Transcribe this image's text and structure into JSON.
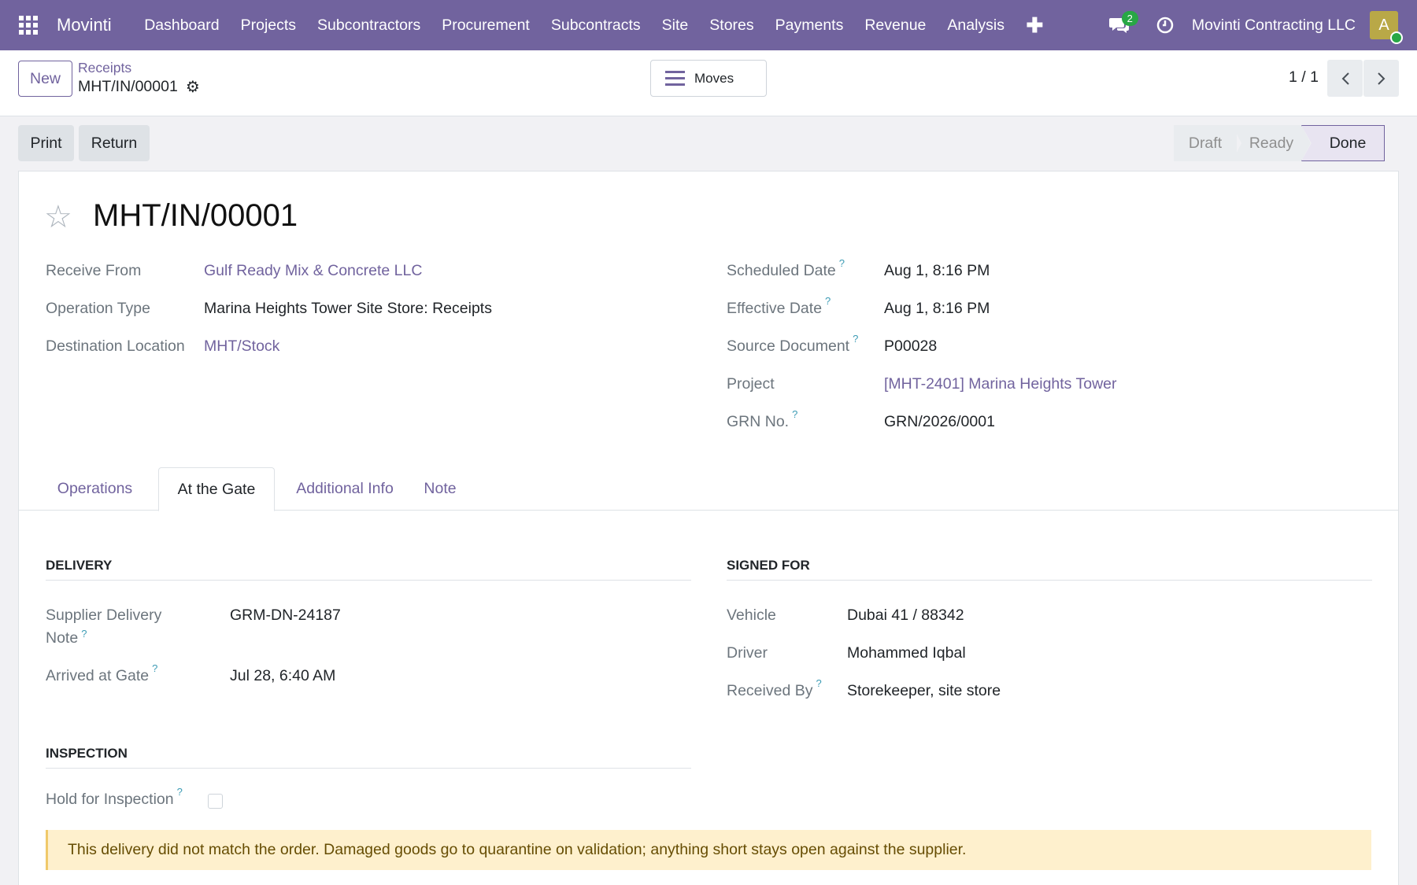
{
  "navbar": {
    "brand": "Movinti",
    "menu": [
      "Dashboard",
      "Projects",
      "Subcontractors",
      "Procurement",
      "Subcontracts",
      "Site",
      "Stores",
      "Payments",
      "Revenue",
      "Analysis"
    ],
    "messages_count": "2",
    "company": "Movinti Contracting LLC",
    "avatar_initial": "A"
  },
  "control_panel": {
    "new_label": "New",
    "breadcrumb": "Receipts",
    "record_name": "MHT/IN/00001",
    "moves_label": "Moves",
    "pager": "1 / 1"
  },
  "statusbar": {
    "print_label": "Print",
    "return_label": "Return",
    "stages": [
      "Draft",
      "Ready",
      "Done"
    ],
    "current_stage": "Done"
  },
  "form": {
    "title": "MHT/IN/00001",
    "left": {
      "receive_from_label": "Receive From",
      "receive_from": "Gulf Ready Mix & Concrete LLC",
      "operation_type_label": "Operation Type",
      "operation_type": "Marina Heights Tower Site Store: Receipts",
      "destination_label": "Destination Location",
      "destination": "MHT/Stock"
    },
    "right": {
      "scheduled_date_label": "Scheduled Date",
      "scheduled_date": "Aug 1, 8:16 PM",
      "effective_date_label": "Effective Date",
      "effective_date": "Aug 1, 8:16 PM",
      "source_document_label": "Source Document",
      "source_document": "P00028",
      "project_label": "Project",
      "project": "[MHT-2401] Marina Heights Tower",
      "grn_label": "GRN No.",
      "grn": "GRN/2026/0001"
    },
    "tabs": [
      "Operations",
      "At the Gate",
      "Additional Info",
      "Note"
    ],
    "active_tab": "At the Gate",
    "delivery": {
      "title": "Delivery",
      "supplier_note_label_1": "Supplier Delivery",
      "supplier_note_label_2": "Note",
      "supplier_note": "GRM-DN-24187",
      "arrived_label": "Arrived at Gate",
      "arrived": "Jul 28, 6:40 AM"
    },
    "signed_for": {
      "title": "Signed For",
      "vehicle_label": "Vehicle",
      "vehicle": "Dubai 41 / 88342",
      "driver_label": "Driver",
      "driver": "Mohammed Iqbal",
      "received_by_label": "Received By",
      "received_by": "Storekeeper, site store"
    },
    "inspection": {
      "title": "Inspection",
      "hold_label": "Hold for Inspection",
      "hold_checked": false
    },
    "alert": "This delivery did not match the order. Damaged goods go to quarantine on validation; anything short stays open against the supplier."
  },
  "colors": {
    "brand": "#71639e",
    "alert_bg": "#fef0cd",
    "badge": "#28a745"
  }
}
